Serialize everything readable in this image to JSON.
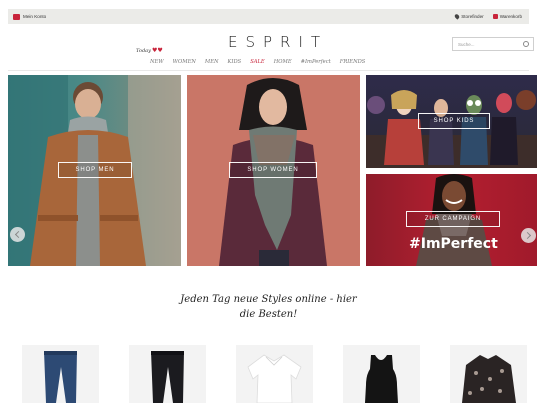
{
  "topbar": {
    "account_label": "Mein Konto",
    "store_finder_label": "Storefinder",
    "cart_label": "Warenkorb"
  },
  "brand": {
    "logo": "ESPRIT"
  },
  "search": {
    "placeholder": "Suche..."
  },
  "today_badge": "Today",
  "nav": {
    "items": [
      "NEW",
      "WOMEN",
      "MEN",
      "KIDS",
      "SALE",
      "HOME",
      "#ImPerfect",
      "FRIENDS"
    ]
  },
  "hero": {
    "men_label": "SHOP MEN",
    "women_label": "SHOP WOMEN",
    "kids_label": "SHOP KIDS",
    "campaign_label": "ZUR CAMPAIGN",
    "campaign_hashtag": "#ImPerfect"
  },
  "tagline": {
    "line1": "Jeden Tag neue Styles online - hier",
    "line2": "die Besten!"
  },
  "products": [
    {
      "icon": "jeans-blue-icon"
    },
    {
      "icon": "jeans-black-icon"
    },
    {
      "icon": "white-shirt-icon"
    },
    {
      "icon": "black-tank-top-icon"
    },
    {
      "icon": "printed-blouse-icon"
    }
  ],
  "colors": {
    "accent": "#c8243b",
    "topbar_bg": "#ebebe8"
  }
}
